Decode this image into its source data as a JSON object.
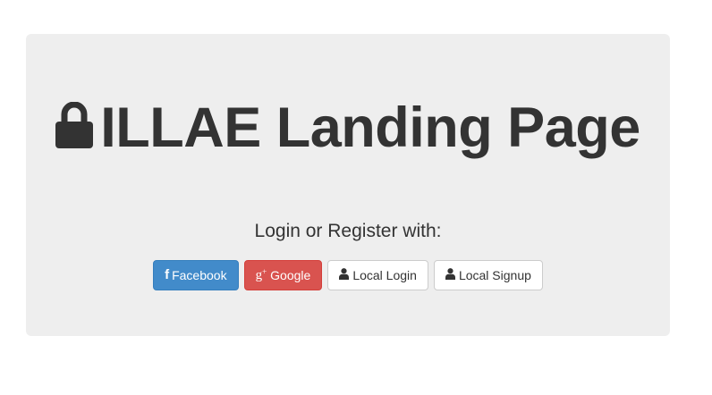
{
  "header": {
    "title": "ILLAE Landing Page",
    "title_icon": "lock-icon"
  },
  "subtitle": "Login or Register with:",
  "buttons": [
    {
      "label": "Facebook",
      "icon": "facebook-icon",
      "color": "#428bca"
    },
    {
      "label": "Google",
      "icon": "google-plus-icon",
      "color": "#d9534f"
    },
    {
      "label": "Local Login",
      "icon": "user-icon",
      "color": "#ffffff"
    },
    {
      "label": "Local Signup",
      "icon": "user-icon",
      "color": "#ffffff"
    }
  ],
  "colors": {
    "panel_background": "#eeeeee",
    "text": "#333333"
  }
}
